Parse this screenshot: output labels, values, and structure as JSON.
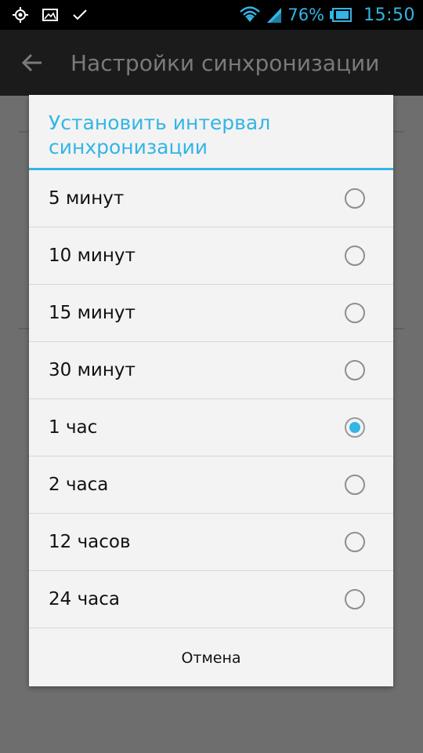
{
  "statusbar": {
    "left_icons": [
      "location-icon",
      "image-icon",
      "check-icon"
    ],
    "battery_percent": "76%",
    "time": "15:50",
    "accent_color": "#33b5e5"
  },
  "actionbar": {
    "title": "Настройки синхронизации",
    "back_icon": "arrow-left-icon"
  },
  "dialog": {
    "title": "Установить интервал синхронизации",
    "options": [
      {
        "label": "5 минут",
        "checked": false
      },
      {
        "label": "10 минут",
        "checked": false
      },
      {
        "label": "15 минут",
        "checked": false
      },
      {
        "label": "30 минут",
        "checked": false
      },
      {
        "label": "1 час",
        "checked": true
      },
      {
        "label": "2 часа",
        "checked": false
      },
      {
        "label": "12 часов",
        "checked": false
      },
      {
        "label": "24 часа",
        "checked": false
      }
    ],
    "cancel_label": "Отмена"
  }
}
